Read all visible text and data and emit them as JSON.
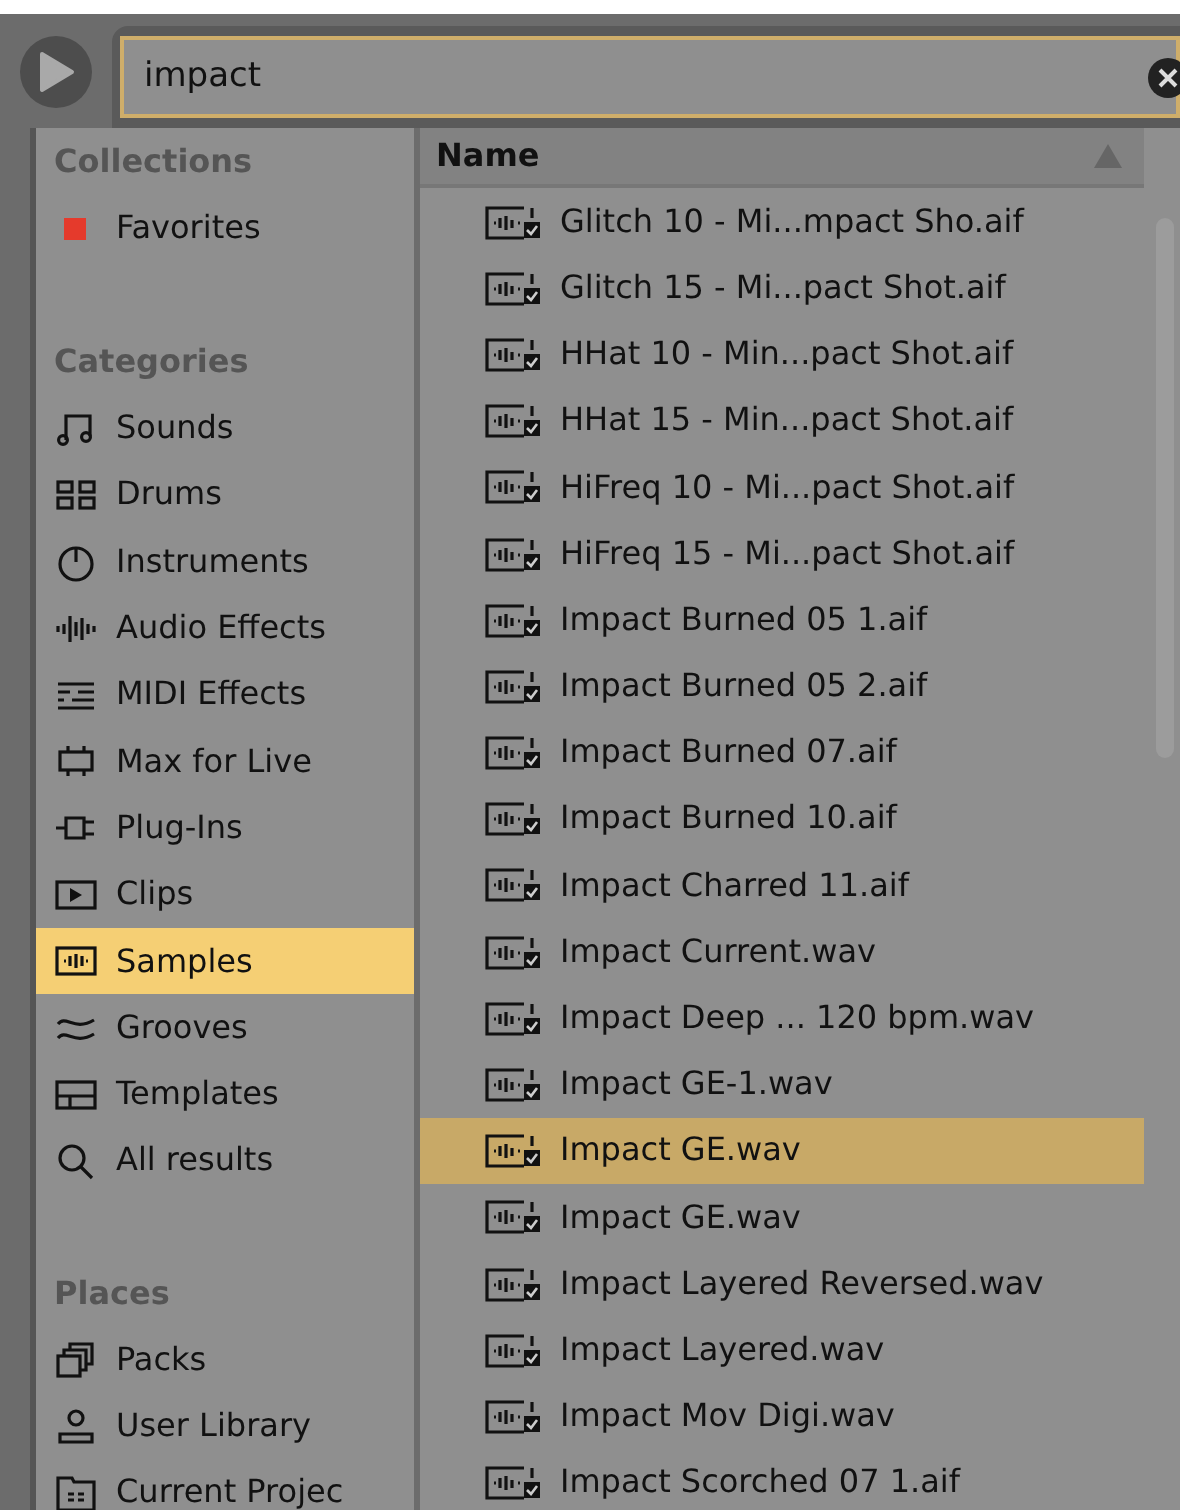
{
  "search": {
    "value": "impact"
  },
  "sidebar": {
    "sections": [
      {
        "title": "Collections",
        "items": [
          {
            "label": "Favorites",
            "selected": false
          }
        ]
      },
      {
        "title": "Categories",
        "items": [
          {
            "label": "Sounds",
            "selected": false
          },
          {
            "label": "Drums",
            "selected": false
          },
          {
            "label": "Instruments",
            "selected": false
          },
          {
            "label": "Audio Effects",
            "selected": false
          },
          {
            "label": "MIDI Effects",
            "selected": false
          },
          {
            "label": "Max for Live",
            "selected": false
          },
          {
            "label": "Plug-Ins",
            "selected": false
          },
          {
            "label": "Clips",
            "selected": false
          },
          {
            "label": "Samples",
            "selected": true
          },
          {
            "label": "Grooves",
            "selected": false
          },
          {
            "label": "Templates",
            "selected": false
          },
          {
            "label": "All results",
            "selected": false
          }
        ]
      },
      {
        "title": "Places",
        "items": [
          {
            "label": "Packs",
            "selected": false
          },
          {
            "label": "User Library",
            "selected": false
          },
          {
            "label": "Current Projec",
            "selected": false
          }
        ]
      }
    ]
  },
  "file_list": {
    "columns": [
      {
        "label": "Name",
        "sort_ascending": true
      }
    ],
    "rows": [
      {
        "name": "Glitch 10 - Mi...mpact Sho.aif",
        "selected": false
      },
      {
        "name": "Glitch 15 - Mi...pact Shot.aif",
        "selected": false
      },
      {
        "name": "HHat 10 - Min...pact Shot.aif",
        "selected": false
      },
      {
        "name": "HHat 15 - Min...pact Shot.aif",
        "selected": false
      },
      {
        "name": "HiFreq 10 - Mi...pact Shot.aif",
        "selected": false
      },
      {
        "name": "HiFreq 15 - Mi...pact Shot.aif",
        "selected": false
      },
      {
        "name": "Impact Burned 05 1.aif",
        "selected": false
      },
      {
        "name": "Impact Burned 05 2.aif",
        "selected": false
      },
      {
        "name": "Impact Burned 07.aif",
        "selected": false
      },
      {
        "name": "Impact Burned 10.aif",
        "selected": false
      },
      {
        "name": "Impact Charred 11.aif",
        "selected": false
      },
      {
        "name": "Impact Current.wav",
        "selected": false
      },
      {
        "name": "Impact Deep ... 120 bpm.wav",
        "selected": false
      },
      {
        "name": "Impact GE-1.wav",
        "selected": false
      },
      {
        "name": "Impact GE.wav",
        "selected": true
      },
      {
        "name": "Impact GE.wav",
        "selected": false
      },
      {
        "name": "Impact Layered Reversed.wav",
        "selected": false
      },
      {
        "name": "Impact Layered.wav",
        "selected": false
      },
      {
        "name": "Impact Mov Digi.wav",
        "selected": false
      },
      {
        "name": "Impact Scorched 07 1.aif",
        "selected": false
      }
    ]
  }
}
